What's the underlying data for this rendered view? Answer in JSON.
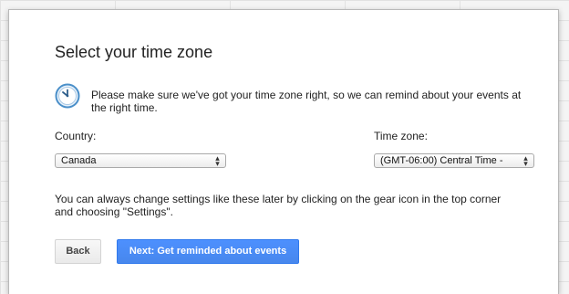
{
  "dialog": {
    "title": "Select your time zone",
    "intro_text": "Please make sure we've got your time zone right, so we can remind about your events at the right time.",
    "icon": "clock-icon",
    "country": {
      "label": "Country:",
      "selected": "Canada"
    },
    "timezone": {
      "label": "Time zone:",
      "selected": "(GMT-06:00) Central Time - "
    },
    "note_text": "You can always change settings like these later by clicking on the gear icon in the top corner and choosing \"Settings\".",
    "buttons": {
      "back_label": "Back",
      "next_label": "Next: Get reminded about events"
    }
  },
  "colors": {
    "primary_button": "#4d90fe",
    "clock_face": "#5a9fd4"
  }
}
